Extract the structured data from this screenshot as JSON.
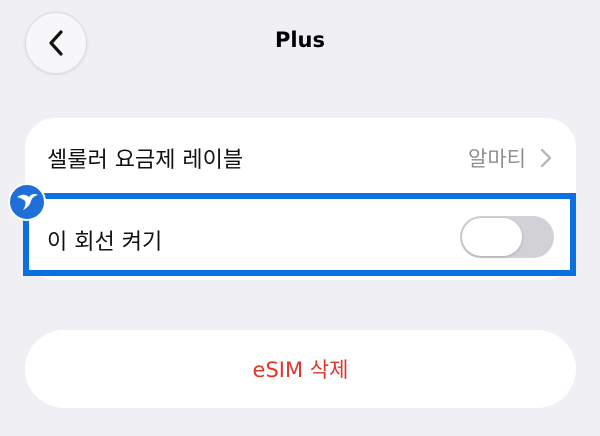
{
  "header": {
    "title": "Plus",
    "back_icon": "chevron-left-icon"
  },
  "settings": {
    "plan_label": {
      "label": "셀룰러 요금제 레이블",
      "value": "알마티",
      "icon": "chevron-right-icon"
    },
    "line_toggle": {
      "label": "이 회선 켜기",
      "state": "off"
    }
  },
  "delete_esim": {
    "label": "eSIM 삭제",
    "color": "#e0362c"
  },
  "highlight": {
    "color": "#0a6fe0",
    "badge_icon": "bird-logo-icon"
  }
}
